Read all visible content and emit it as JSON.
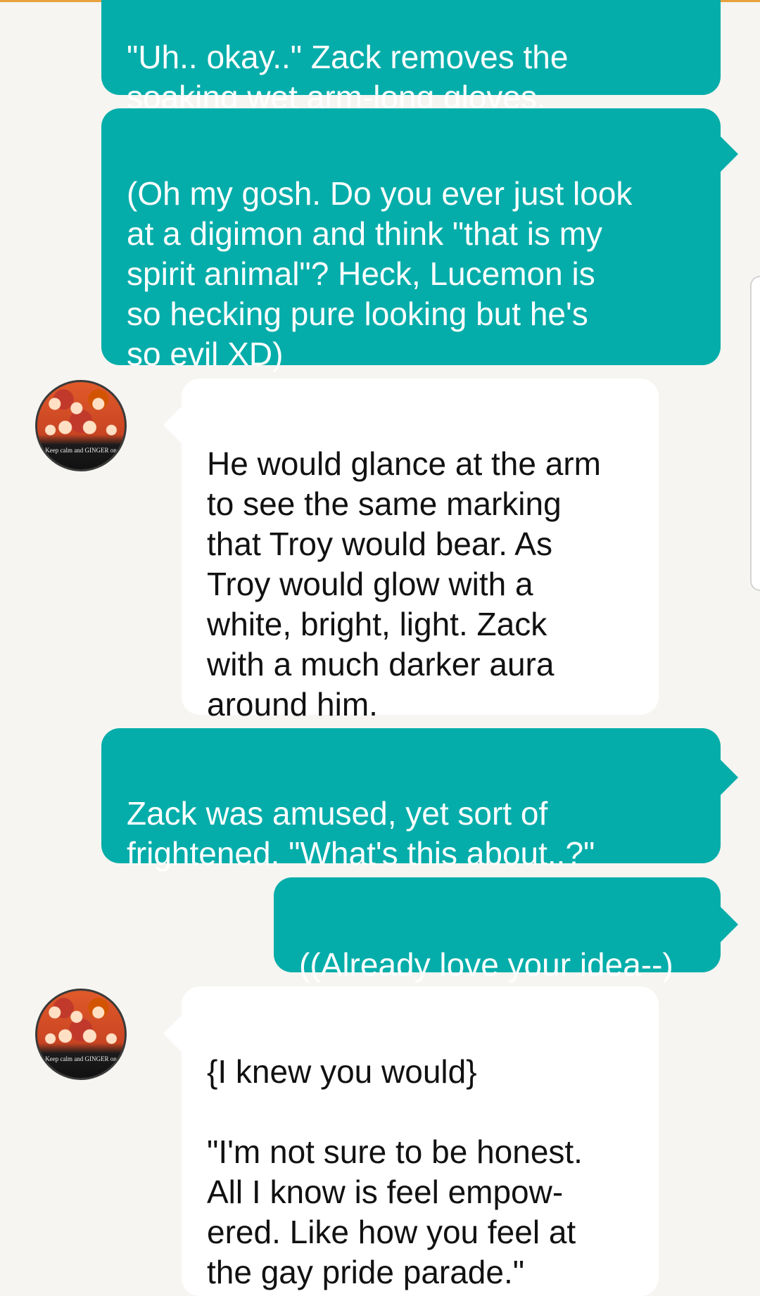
{
  "messages": [
    {
      "sender": "me",
      "text": "\"Uh.. okay..\" Zack removes the\nsoaking wet arm-long gloves."
    },
    {
      "sender": "me",
      "text": "(Oh my gosh. Do you ever just look\nat a digimon and think \"that is my\nspirit animal\"? Heck, Lucemon is\nso hecking pure looking but he's\nso evil XD)"
    },
    {
      "sender": "other",
      "text": "He would glance at the arm\nto see the same marking\nthat Troy would bear. As\nTroy would glow with a\nwhite, bright, light. Zack\nwith a much darker aura\naround him."
    },
    {
      "sender": "me",
      "text": "Zack was amused, yet sort of\nfrightened. \"What's this about..?\""
    },
    {
      "sender": "me",
      "text": "((Already love your idea--)"
    },
    {
      "sender": "other",
      "text": "{I knew you would}\n\n\"I'm not sure to be honest.\nAll I know is feel empow-\nered. Like how you feel at\nthe gay pride parade.\""
    }
  ],
  "avatar": {
    "caption": "Keep calm and GINGER on"
  },
  "colors": {
    "sent_bubble": "#05adaa",
    "received_bubble": "#ffffff",
    "background": "#f6f5f1"
  }
}
